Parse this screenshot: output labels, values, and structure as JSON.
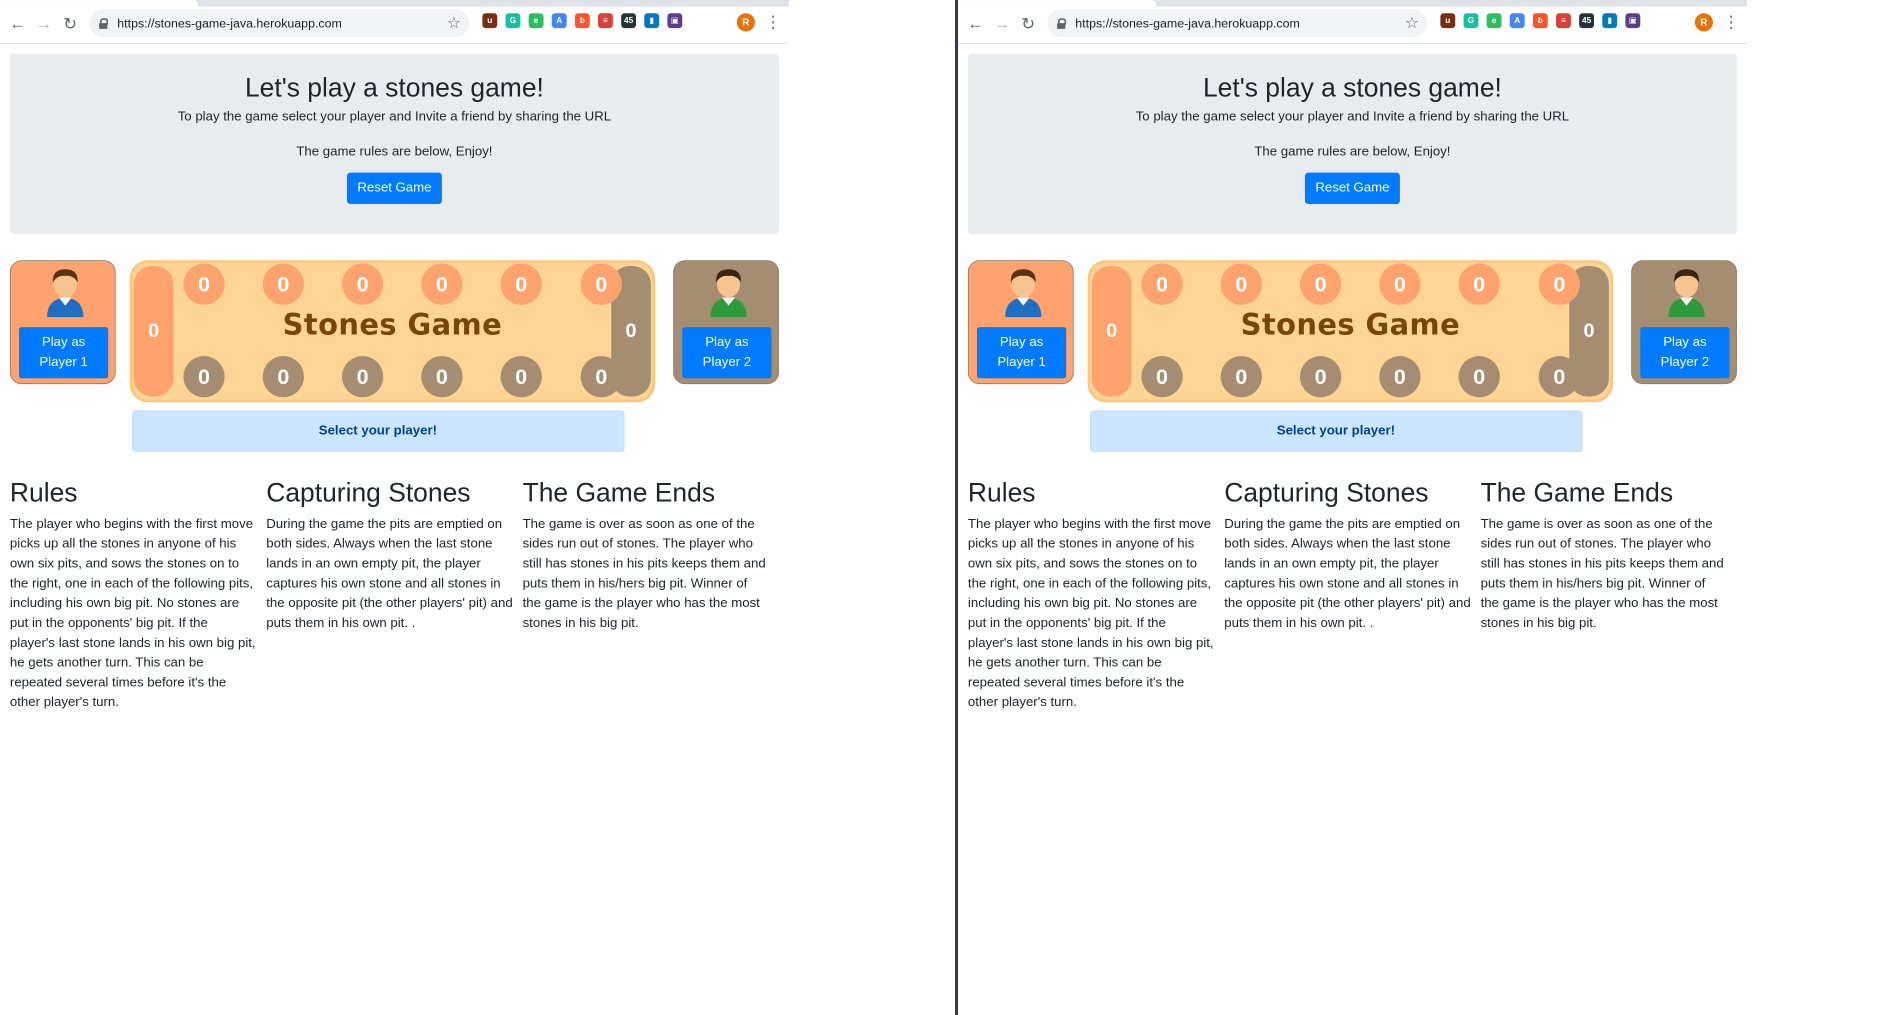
{
  "browser": {
    "url": "https://stones-game-java.herokuapp.com",
    "extensions": [
      {
        "name": "ublock-icon",
        "color": "#7b2d0e",
        "glyph": "u"
      },
      {
        "name": "grammarly-icon",
        "color": "#15c39a",
        "glyph": "G"
      },
      {
        "name": "evernote-icon",
        "color": "#2dbe60",
        "glyph": "e"
      },
      {
        "name": "translate-icon",
        "color": "#4285f4",
        "glyph": "A"
      },
      {
        "name": "brave-icon",
        "color": "#fb542b",
        "glyph": "b"
      },
      {
        "name": "todoist-icon",
        "color": "#db4035",
        "glyph": "≡"
      },
      {
        "name": "counter-icon",
        "color": "#263238",
        "glyph": "45"
      },
      {
        "name": "trello-icon",
        "color": "#0079bf",
        "glyph": "▮"
      },
      {
        "name": "extension-icon",
        "color": "#5a3e8a",
        "glyph": "▣"
      }
    ],
    "avatar": "R"
  },
  "hero": {
    "title": "Let's play a stones game!",
    "subtitle": "To play the game select your player and Invite a friend by sharing the URL",
    "note": "The game rules are below, Enjoy!",
    "reset_label": "Reset Game"
  },
  "players": {
    "p1_label": "Play as Player 1",
    "p2_label": "Play as Player 2"
  },
  "board": {
    "title": "Stones Game",
    "top_pits": [
      "0",
      "0",
      "0",
      "0",
      "0",
      "0"
    ],
    "bottom_pits": [
      "0",
      "0",
      "0",
      "0",
      "0",
      "0"
    ],
    "left_big_pit": "0",
    "right_big_pit": "0",
    "colors": {
      "player1": "#fea36e",
      "player2": "#a58d71",
      "board": "#ffd595"
    }
  },
  "status": "Select your player!",
  "rules": [
    {
      "title": "Rules",
      "text": "The player who begins with the first move picks up all the stones in anyone of his own six pits, and sows the stones on to the right, one in each of the following pits, including his own big pit. No stones are put in the opponents' big pit. If the player's last stone lands in his own big pit, he gets another turn. This can be repeated several times before it's the other player's turn."
    },
    {
      "title": "Capturing Stones",
      "text": "During the game the pits are emptied on both sides. Always when the last stone lands in an own empty pit, the player captures his own stone and all stones in the opposite pit (the other players' pit) and puts them in his own pit. ."
    },
    {
      "title": "The Game Ends",
      "text": "The game is over as soon as one of the sides run out of stones. The player who still has stones in his pits keeps them and puts them in his/hers big pit. Winner of the game is the player who has the most stones in his big pit."
    }
  ]
}
